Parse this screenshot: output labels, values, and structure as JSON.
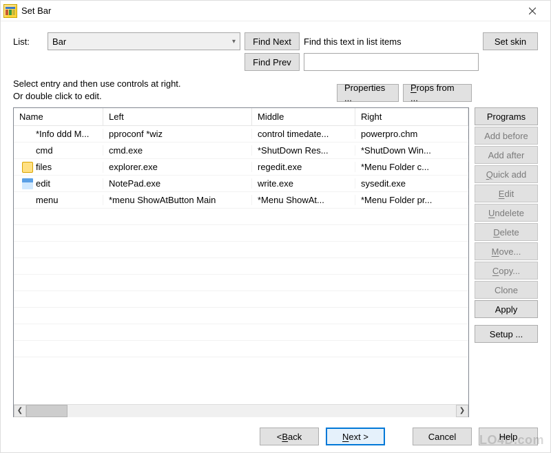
{
  "window": {
    "title": "Set Bar"
  },
  "top": {
    "list_label": "List:",
    "list_value": "Bar",
    "find_next": "Find Next",
    "find_prev": "Find Prev",
    "find_label": "Find this text in list items",
    "find_value": "",
    "set_skin": "Set skin"
  },
  "instruction": {
    "line1": "Select entry and then use controls at right.",
    "line2": "Or double click to edit."
  },
  "buttons_mid": {
    "properties": "Properties ...",
    "props_from": "Props from ..."
  },
  "columns": [
    "Name",
    "Left",
    "Middle",
    "Right"
  ],
  "rows": [
    {
      "icon": "",
      "name": "*Info ddd M...",
      "left": "pproconf *wiz",
      "middle": "control timedate...",
      "right": "powerpro.chm"
    },
    {
      "icon": "",
      "name": "cmd",
      "left": "cmd.exe",
      "middle": "*ShutDown Res...",
      "right": "*ShutDown Win..."
    },
    {
      "icon": "folder",
      "name": "files",
      "left": "explorer.exe",
      "middle": "regedit.exe",
      "right": "*Menu Folder c..."
    },
    {
      "icon": "notepad",
      "name": "edit",
      "left": "NotePad.exe",
      "middle": "write.exe",
      "right": "sysedit.exe"
    },
    {
      "icon": "",
      "name": "menu",
      "left": "*menu ShowAtButton Main",
      "middle": "*Menu ShowAt...",
      "right": "*Menu Folder pr..."
    }
  ],
  "side": {
    "programs": "Programs",
    "add_before": "Add before",
    "add_after": "Add after",
    "quick_add": "Quick add",
    "edit": "Edit",
    "undelete": "Undelete",
    "delete": "Delete",
    "move": "Move...",
    "copy": "Copy...",
    "clone": "Clone",
    "apply": "Apply",
    "setup": "Setup ..."
  },
  "footer": {
    "back": "< Back",
    "next": "Next >",
    "cancel": "Cancel",
    "help": "Help"
  },
  "watermark": "LO4D.com"
}
